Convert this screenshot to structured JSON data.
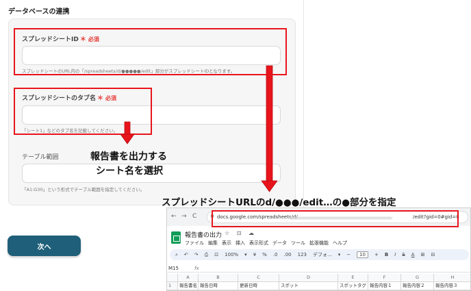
{
  "form": {
    "section_title": "データベースの連携",
    "fields": [
      {
        "label": "スプレッドシートID",
        "required_mark": "＊",
        "required_label": "必須",
        "value": "",
        "hint": "スプレッドシートのURL内の「/spreadsheets/d/●●●●●/edit」部分がスプレッドシートIDとなります。"
      },
      {
        "label": "スプレッドシートのタブ名",
        "required_mark": "＊",
        "required_label": "必須",
        "value": "",
        "hint": "「シート1」などのタブ名を記載してください。"
      },
      {
        "label": "テーブル範囲",
        "value": "",
        "hint": "「A1:G30」という形式でテーブル範囲を指定してください。"
      }
    ],
    "next_button": "次へ"
  },
  "annotations": {
    "tab_note_line1": "報告書を出力する",
    "tab_note_line2": "シート名を選択",
    "url_note": "スプレッドシートURLのd/●●●/edit…の●部分を指定"
  },
  "browser": {
    "nav_back": "←",
    "nav_forward": "→",
    "nav_reload": "C",
    "site_icon": "⚙",
    "url_prefix": "docs.google.com/spreadsheets/d/",
    "url_suffix": "/edit?gid=0#gid=0",
    "doc_title": "報告書の出力",
    "title_icons": "☆ ⊡ ☁",
    "menu": [
      "ファイル",
      "編集",
      "表示",
      "挿入",
      "表示形式",
      "データ",
      "ツール",
      "拡張機能",
      "ヘルプ"
    ],
    "toolbar": [
      "⌕",
      "↶",
      "↷",
      "⎙",
      "⊡",
      "100%",
      "▾",
      "¥",
      "%",
      ".0",
      ".00",
      "123",
      "デフォ...",
      "▾",
      "−",
      "10",
      "+",
      "B",
      "I",
      "S",
      "A",
      "⊞",
      "⊟"
    ],
    "font_size": "10",
    "name_box": "M15",
    "fx": "fx",
    "columns": [
      "",
      "A",
      "B",
      "C",
      "D",
      "E",
      "F",
      "G",
      "H"
    ],
    "row1": [
      "1",
      "報告書名",
      "報告日時",
      "更新日時",
      "スポット",
      "スポットタグ",
      "報告内容１",
      "報告内容２",
      "報告内容３"
    ]
  },
  "colors": {
    "highlight": "#e8141b",
    "button": "#1f5f7a",
    "sheets_green": "#0f9d58"
  }
}
